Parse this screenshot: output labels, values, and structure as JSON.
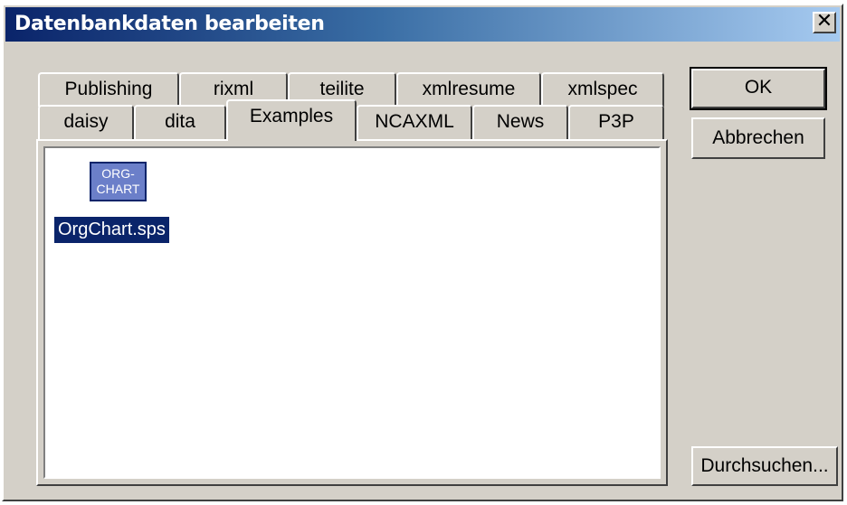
{
  "window": {
    "title": "Datenbankdaten bearbeiten",
    "close_glyph": "✕"
  },
  "tabs": {
    "row1": [
      "Publishing",
      "rixml",
      "teilite",
      "xmlresume",
      "xmlspec"
    ],
    "row2": [
      "daisy",
      "dita",
      "Examples",
      "NCAXML",
      "News",
      "P3P"
    ],
    "active": "Examples"
  },
  "file_list": {
    "items": [
      {
        "icon_lines": [
          "ORG-",
          "CHART"
        ],
        "label": "OrgChart.sps",
        "selected": true
      }
    ]
  },
  "buttons": {
    "ok": "OK",
    "cancel": "Abbrechen",
    "browse": "Durchsuchen..."
  },
  "colors": {
    "title_gradient_start": "#0a246a",
    "title_gradient_end": "#a6caf0",
    "selection": "#0a246a",
    "face": "#d4d0c8"
  }
}
